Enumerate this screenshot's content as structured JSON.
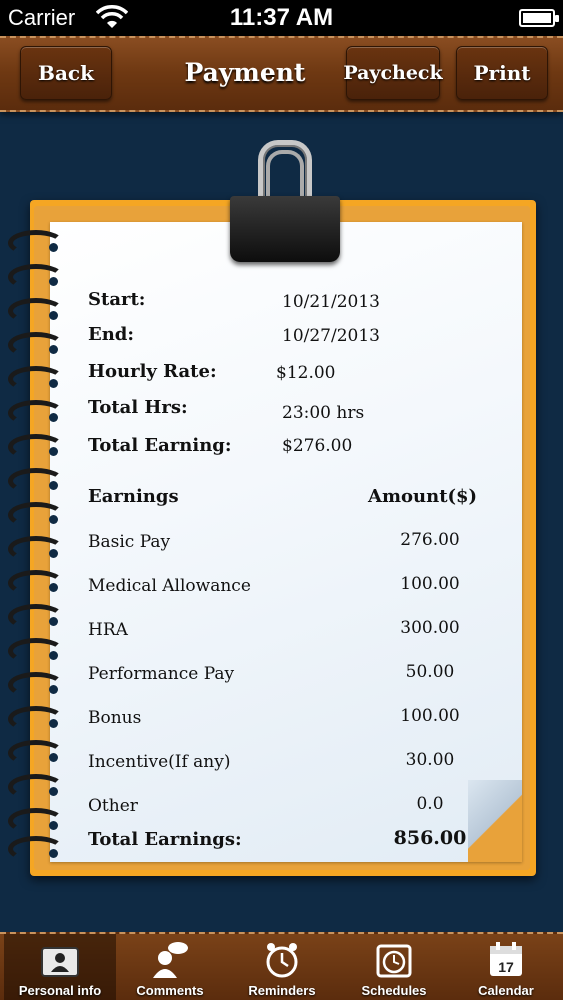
{
  "status_bar": {
    "carrier": "Carrier",
    "time": "11:37 AM"
  },
  "nav": {
    "back_label": "Back",
    "title": "Payment",
    "paycheck_label": "Paycheck",
    "print_label": "Print"
  },
  "summary": {
    "start_label": "Start:",
    "start_value": "10/21/2013",
    "end_label": "End:",
    "end_value": "10/27/2013",
    "rate_label": "Hourly Rate:",
    "rate_value": "$12.00",
    "hours_label": "Total Hrs:",
    "hours_value": "23:00 hrs",
    "earning_label": "Total Earning:",
    "earning_value": "$276.00"
  },
  "table": {
    "col_earnings": "Earnings",
    "col_amount": "Amount($)",
    "rows": [
      {
        "name": "Basic Pay",
        "amount": "276.00"
      },
      {
        "name": "Medical Allowance",
        "amount": "100.00"
      },
      {
        "name": "HRA",
        "amount": "300.00"
      },
      {
        "name": "Performance Pay",
        "amount": "50.00"
      },
      {
        "name": "Bonus",
        "amount": "100.00"
      },
      {
        "name": "Incentive(If any)",
        "amount": "30.00"
      },
      {
        "name": "Other",
        "amount": "0.0"
      }
    ],
    "total_label": "Total Earnings:",
    "total_value": "856.00"
  },
  "tabs": [
    {
      "label": "Personal info",
      "icon": "person-folder-icon"
    },
    {
      "label": "Comments",
      "icon": "comment-person-icon"
    },
    {
      "label": "Reminders",
      "icon": "alarm-clock-icon"
    },
    {
      "label": "Schedules",
      "icon": "clock-calendar-icon"
    },
    {
      "label": "Calendar",
      "icon": "calendar-icon",
      "day": "17"
    }
  ]
}
